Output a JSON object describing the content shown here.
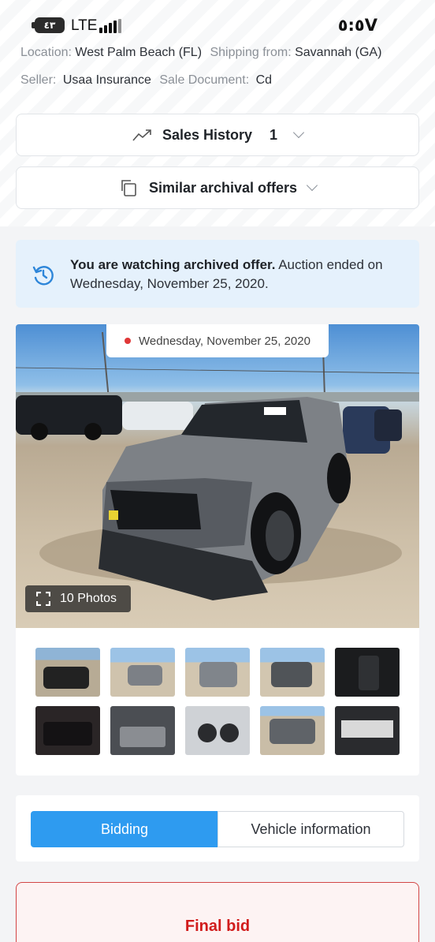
{
  "status_bar": {
    "battery": "٤٣",
    "network": "LTE",
    "time": "٥:٥V"
  },
  "lot_info": {
    "location_label": "Location:",
    "location_value": "West Palm Beach (FL)",
    "shipping_label": "Shipping from:",
    "shipping_value": "Savannah (GA)",
    "seller_label": "Seller:",
    "seller_value": "Usaa Insurance",
    "document_label": "Sale Document:",
    "document_value": "Cd"
  },
  "sales_history": {
    "label": "Sales History",
    "count": "1"
  },
  "similar_offers": {
    "label": "Similar archival offers"
  },
  "notice": {
    "bold": "You are watching archived offer.",
    "rest": " Auction ended on Wednesday, November 25, 2020."
  },
  "gallery": {
    "date": "Wednesday, November 25, 2020",
    "photos_label": "10 Photos"
  },
  "tabs": {
    "bidding": "Bidding",
    "vehicle_info": "Vehicle information"
  },
  "final_bid": {
    "label": "Final bid"
  },
  "colors": {
    "accent": "#2e9bf0",
    "notice_bg": "#e5f1fc",
    "danger": "#d11c1c"
  },
  "icons": [
    "trend-chart-icon",
    "chevron-down-icon",
    "copy-pages-icon",
    "history-icon",
    "fullscreen-icon"
  ]
}
